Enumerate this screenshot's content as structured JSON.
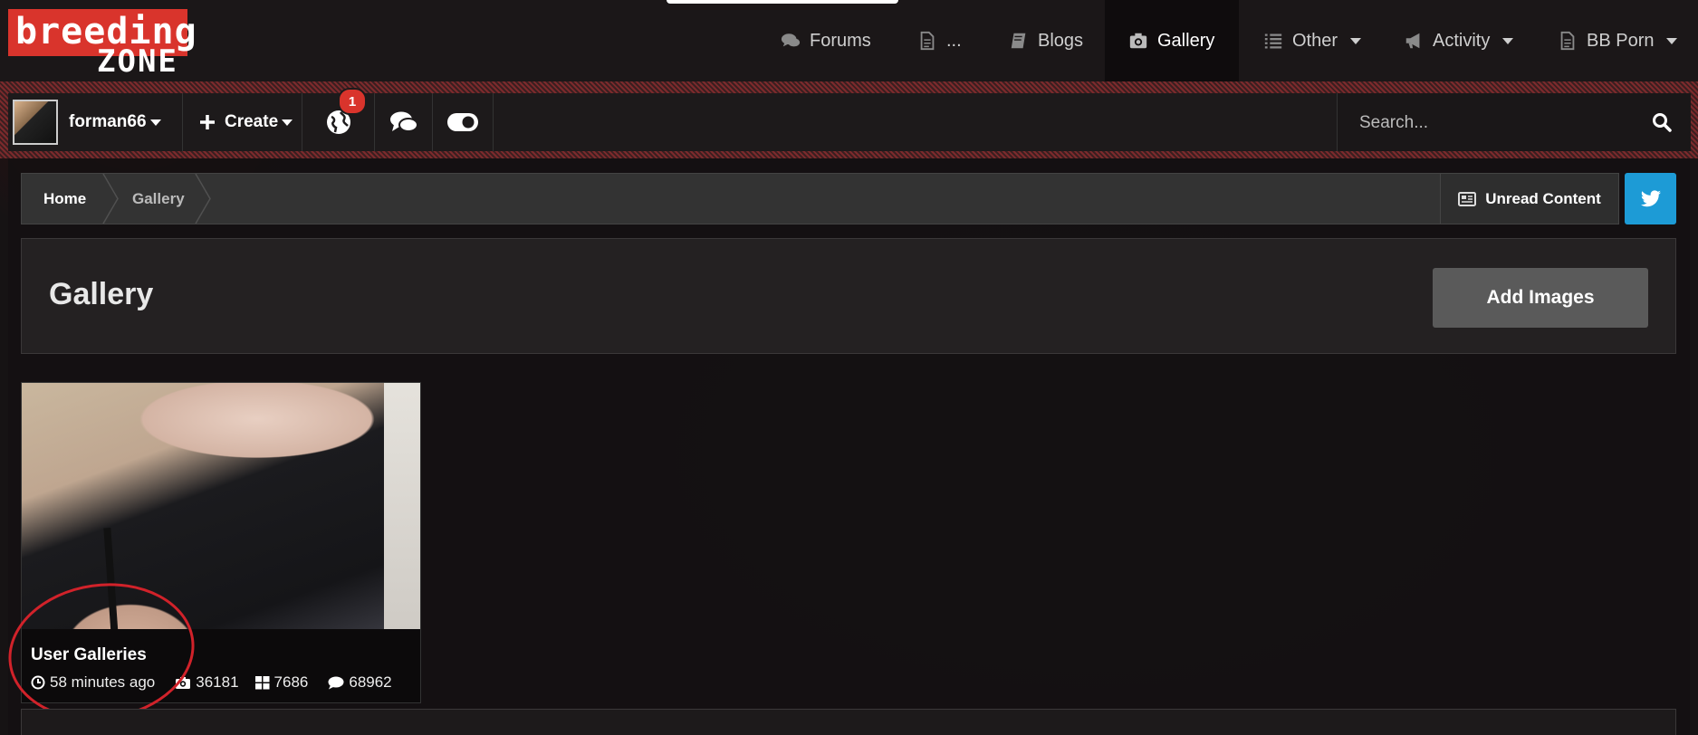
{
  "logo": {
    "line1": "breeding",
    "line2": "ZONE"
  },
  "topnav": {
    "items": [
      {
        "label": "Forums",
        "icon": "comments-icon"
      },
      {
        "label": "...",
        "icon": "document-icon"
      },
      {
        "label": "Blogs",
        "icon": "book-icon"
      },
      {
        "label": "Gallery",
        "icon": "camera-icon",
        "active": true
      },
      {
        "label": "Other",
        "icon": "list-icon",
        "dropdown": true
      },
      {
        "label": "Activity",
        "icon": "megaphone-icon",
        "dropdown": true
      },
      {
        "label": "BB Porn",
        "icon": "document-icon",
        "dropdown": true
      }
    ]
  },
  "userbar": {
    "username": "forman66",
    "create_label": "Create",
    "notification_count": "1"
  },
  "search": {
    "placeholder": "Search..."
  },
  "breadcrumb": {
    "home": "Home",
    "current": "Gallery"
  },
  "unread_label": "Unread Content",
  "page": {
    "title": "Gallery",
    "add_images_label": "Add Images"
  },
  "card": {
    "title": "User Galleries",
    "time": "58 minutes ago",
    "images": "36181",
    "albums": "7686",
    "comments": "68962"
  },
  "colors": {
    "brand": "#d9342c",
    "twitter": "#1d9bd6",
    "button": "#5a5a5a"
  }
}
